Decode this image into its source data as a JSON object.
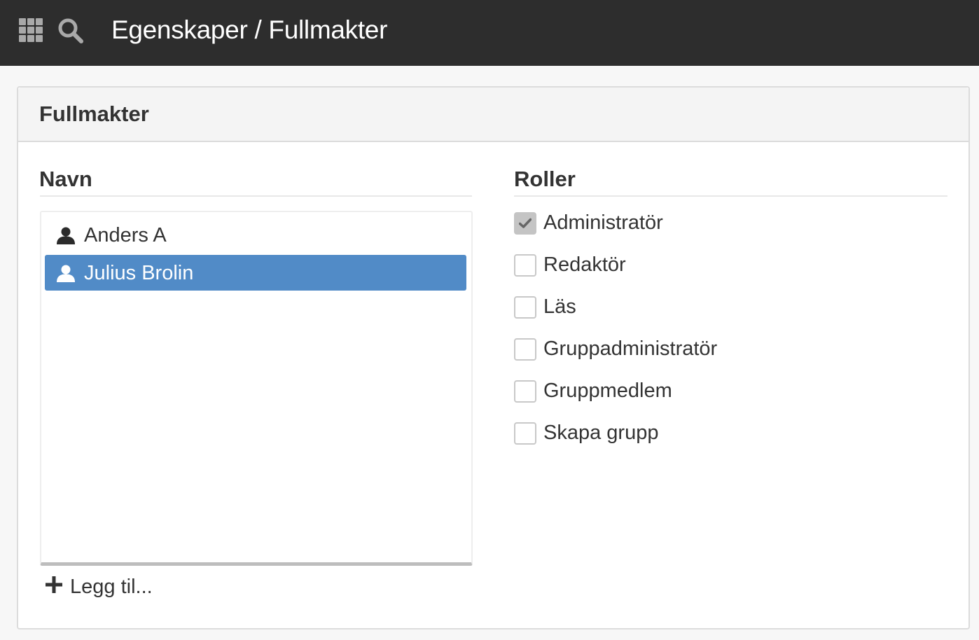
{
  "topbar": {
    "title": "Egenskaper / Fullmakter",
    "apps_icon": "grid-apps-icon",
    "search_icon": "search-icon",
    "background": "#2d2d2d"
  },
  "panel": {
    "title": "Fullmakter"
  },
  "names": {
    "heading": "Navn",
    "items": [
      {
        "label": "Anders A",
        "icon": "user-icon",
        "selected": false
      },
      {
        "label": "Julius Brolin",
        "icon": "user-icon",
        "selected": true
      }
    ],
    "add_label": "Legg til...",
    "selected_color": "#518bc7"
  },
  "roles": {
    "heading": "Roller",
    "items": [
      {
        "label": "Administratör",
        "checked": true
      },
      {
        "label": "Redaktör",
        "checked": false
      },
      {
        "label": "Läs",
        "checked": false
      },
      {
        "label": "Gruppadministratör",
        "checked": false
      },
      {
        "label": "Gruppmedlem",
        "checked": false
      },
      {
        "label": "Skapa grupp",
        "checked": false
      }
    ]
  }
}
